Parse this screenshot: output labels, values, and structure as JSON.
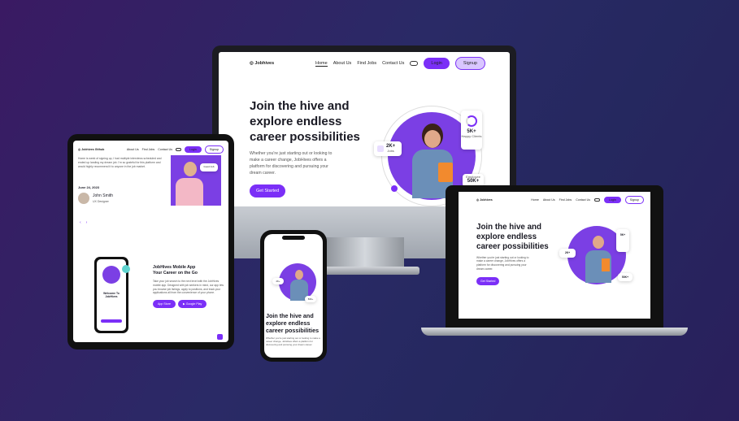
{
  "brand": "Jobhives",
  "nav": {
    "home": "Home",
    "about": "About Us",
    "find": "Find Jobs",
    "contact": "Contact Us",
    "login": "Login",
    "signup": "Signup"
  },
  "hero": {
    "title_l1": "Join the hive and",
    "title_l2": "explore endless",
    "title_l3": "career possibilities",
    "body": "Whether you're just starting out or looking to make a career change, JobHives offers a platform for discovering and pursuing your dream career.",
    "cta": "Get Started",
    "stat1_value": "5K+",
    "stat1_label": "Happy Clients",
    "stat2_value": "2K+",
    "stat2_label": "Jobs",
    "stat3_label": "Employee",
    "stat3_value": "50K+"
  },
  "tablet": {
    "brand": "Jobhives Github",
    "testimonial": "Home is week of signing up, I had multiple interviews scheduled and ended up landing my dream job. I'm so grateful for this platform and would highly recommend it to anyone in the job market.",
    "date": "June 24, 2023",
    "name": "John Smith",
    "role": "UX Designer",
    "app_title_l1": "JobHives Mobile App",
    "app_title_l2": "Your Career on the Go",
    "app_body": "Take your job search to the next level with the JobHives mobile app. Designed with job seekers in mind, our app lets you browse job listings, apply to positions, and track your applications all from the convenience of your phone.",
    "app_store": "App Store",
    "google_play": "Google Play",
    "phone_welcome_l1": "Welcome To",
    "phone_welcome_l2": "JobHives",
    "side_card": "Good Job"
  },
  "colors": {
    "accent": "#7b2ff7",
    "circle": "#7b3fe4",
    "bg": "#2c2466"
  }
}
